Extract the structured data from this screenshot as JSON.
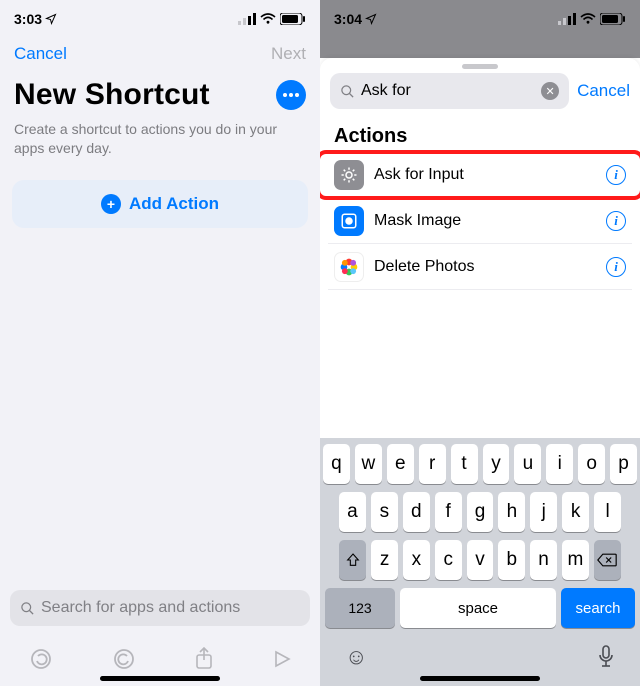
{
  "left": {
    "status_time": "3:03",
    "nav": {
      "cancel": "Cancel",
      "next": "Next"
    },
    "title": "New Shortcut",
    "subtitle": "Create a shortcut to actions you do in your apps every day.",
    "add_action": "Add Action",
    "search_placeholder": "Search for apps and actions"
  },
  "right": {
    "status_time": "3:04",
    "search_value": "Ask for",
    "cancel": "Cancel",
    "actions_heading": "Actions",
    "rows": [
      {
        "label": "Ask for Input",
        "icon": "gear-icon",
        "bg": "#8e8e93",
        "highlight": true
      },
      {
        "label": "Mask Image",
        "icon": "mask-icon",
        "bg": "#007aff",
        "highlight": false
      },
      {
        "label": "Delete Photos",
        "icon": "photos-icon",
        "bg": "#ffffff",
        "highlight": false
      }
    ],
    "keyboard": {
      "row1": [
        "q",
        "w",
        "e",
        "r",
        "t",
        "y",
        "u",
        "i",
        "o",
        "p"
      ],
      "row2": [
        "a",
        "s",
        "d",
        "f",
        "g",
        "h",
        "j",
        "k",
        "l"
      ],
      "row3": [
        "z",
        "x",
        "c",
        "v",
        "b",
        "n",
        "m"
      ],
      "numkey": "123",
      "space": "space",
      "search": "search"
    }
  }
}
